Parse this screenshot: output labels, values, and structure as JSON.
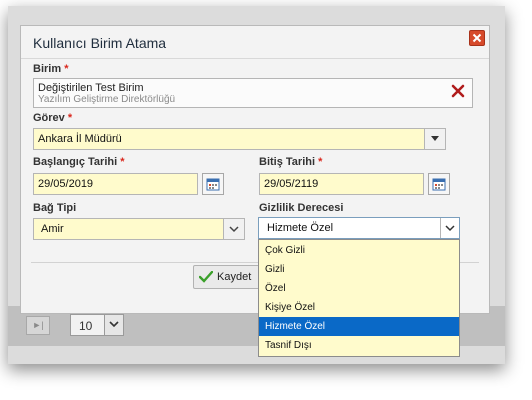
{
  "background": {
    "pager_first_icon": "first-page-icon",
    "page_size": "10"
  },
  "dialog": {
    "title": "Kullanıcı Birim Atama",
    "close_icon": "close-icon",
    "birim": {
      "label": "Birim",
      "required": "*",
      "value_line1": "Değiştirilen Test Birim",
      "value_line2": "Yazılım Geliştirme Direktörlüğü",
      "clear_icon": "clear-x-icon"
    },
    "gorev": {
      "label": "Görev",
      "required": "*",
      "value": "Ankara İl Müdürü"
    },
    "baslangic": {
      "label": "Başlangıç Tarihi",
      "required": "*",
      "value": "29/05/2019"
    },
    "bitis": {
      "label": "Bitiş Tarihi",
      "required": "*",
      "value": "29/05/2119"
    },
    "bag_tipi": {
      "label": "Bağ Tipi",
      "value": "Amir"
    },
    "gizlilik": {
      "label": "Gizlilik Derecesi",
      "value": "Hizmete Özel",
      "options": [
        "Çok Gizli",
        "Gizli",
        "Özel",
        "Kişiye Özel",
        "Hizmete Özel",
        "Tasnif Dışı"
      ],
      "selected_index": 4
    },
    "save_label": "Kaydet"
  },
  "colors": {
    "field_bg": "#fffbcc",
    "selected_option": "#0a69c7",
    "required_star": "#d9261c",
    "close_button": "#d64a2b"
  }
}
